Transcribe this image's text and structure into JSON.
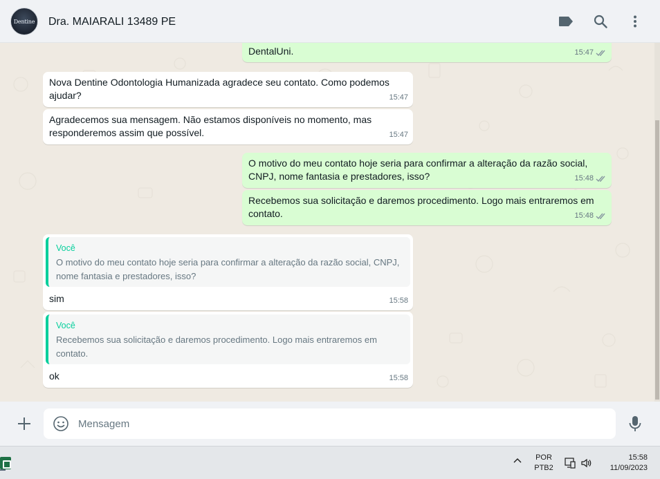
{
  "header": {
    "avatar_text": "Dentine",
    "contact_name": "Dra. MAIARALI 13489 PE"
  },
  "messages": [
    {
      "type": "out",
      "text": "DentalUni.",
      "time": "15:47"
    },
    {
      "type": "in",
      "text": "Nova Dentine Odontologia Humanizada agradece seu contato. Como podemos ajudar?",
      "time": "15:47"
    },
    {
      "type": "in",
      "text": "Agradecemos sua mensagem. Não estamos disponíveis no momento, mas responderemos assim que possível.",
      "time": "15:47"
    },
    {
      "type": "out",
      "text": "O motivo do meu contato hoje seria para confirmar a alteração da razão social, CNPJ, nome fantasia e prestadores, isso?",
      "time": "15:48"
    },
    {
      "type": "out",
      "text": "Recebemos sua solicitação e daremos procedimento. Logo mais entraremos em contato.",
      "time": "15:48"
    },
    {
      "type": "in",
      "quote_author": "Você",
      "quote_text": "O motivo do meu contato hoje seria para confirmar a alteração da razão social, CNPJ, nome fantasia e prestadores, isso?",
      "text": "sim",
      "time": "15:58"
    },
    {
      "type": "in",
      "quote_author": "Você",
      "quote_text": "Recebemos sua solicitação e daremos procedimento. Logo mais entraremos em contato.",
      "text": "ok",
      "time": "15:58"
    }
  ],
  "composer": {
    "placeholder": "Mensagem"
  },
  "taskbar": {
    "lang_line1": "POR",
    "lang_line2": "PTB2",
    "time": "15:58",
    "date": "11/09/2023"
  },
  "colors": {
    "outgoing_bubble": "#d9fdd3",
    "incoming_bubble": "#ffffff",
    "chat_background": "#efeae2",
    "quote_accent": "#06cf9c",
    "read_tick": "#8696a0"
  }
}
